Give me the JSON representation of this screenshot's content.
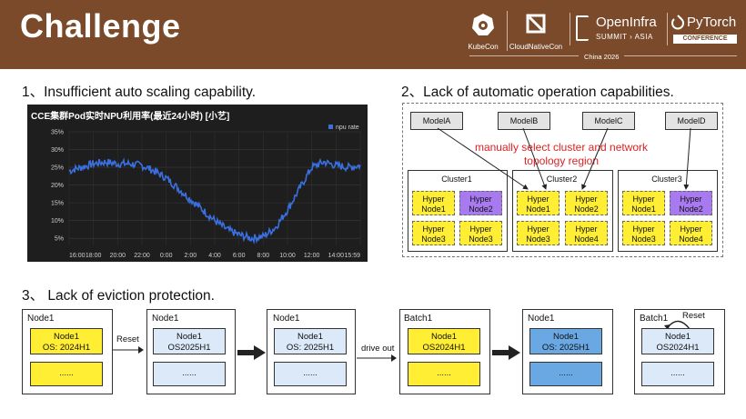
{
  "header": {
    "title": "Challenge",
    "logos": [
      {
        "name": "KubeCon",
        "label": "KubeCon"
      },
      {
        "name": "CloudNativeCon",
        "label": "CloudNativeCon"
      },
      {
        "name": "OpenInfra",
        "label": "OpenInfra",
        "sub": "SUMMIT › ASIA"
      },
      {
        "name": "PyTorch",
        "label": "PyTorch",
        "sub": "CONFERENCE"
      }
    ],
    "event": "China 2026"
  },
  "section1": {
    "title": "1、Insufficient auto scaling capability.",
    "chart_title": "CCE集群Pod实时NPU利用率(最近24小时) [小艺]",
    "legend": "npu rate"
  },
  "chart_data": {
    "type": "line",
    "title": "CCE集群Pod实时NPU利用率(最近24小时) [小艺]",
    "xlabel": "",
    "ylabel": "",
    "x_ticks": [
      "16:00",
      "18:00",
      "20:00",
      "22:00",
      "0:00",
      "2:00",
      "4:00",
      "6:00",
      "8:00",
      "10:00",
      "12:00",
      "14:00",
      "15:59"
    ],
    "y_ticks": [
      "35%",
      "30%",
      "25%",
      "20%",
      "15%",
      "10%",
      "5%"
    ],
    "ylim": [
      3,
      35
    ],
    "grid": true,
    "legend_position": "top-right",
    "series": [
      {
        "name": "npu rate",
        "color": "#3a6fe0",
        "x": [
          0,
          1,
          2,
          3,
          4,
          5,
          6,
          7,
          8,
          9,
          10,
          11,
          12,
          13,
          14,
          15,
          16,
          17,
          18,
          19,
          20,
          21,
          22,
          23,
          24
        ],
        "values": [
          24,
          25,
          26,
          26.5,
          26,
          26,
          25.5,
          24,
          22,
          19,
          16,
          13,
          10,
          7.5,
          6,
          5,
          5.5,
          8,
          13,
          19,
          25,
          26.5,
          25.5,
          25,
          25.5
        ]
      }
    ]
  },
  "section2": {
    "title": "2、Lack of automatic operation capabilities.",
    "models": [
      "ModelA",
      "ModelB",
      "ModelC",
      "ModelD"
    ],
    "note": "manually select cluster and network topology region",
    "clusters": [
      {
        "label": "Cluster1",
        "nodes": [
          "Hyper Node1",
          "Hyper Node2",
          "Hyper Node3",
          "Hyper Node3"
        ],
        "colors": [
          "yellow",
          "purple",
          "yellow",
          "yellow"
        ]
      },
      {
        "label": "Cluster2",
        "nodes": [
          "Hyper Node1",
          "Hyper Node2",
          "Hyper Node3",
          "Hyper Node4"
        ],
        "colors": [
          "yellow",
          "yellow",
          "yellow",
          "yellow"
        ]
      },
      {
        "label": "Cluster3",
        "nodes": [
          "Hyper Node1",
          "Hyper Node2",
          "Hyper Node3",
          "Hyper Node4"
        ],
        "colors": [
          "yellow",
          "purple",
          "yellow",
          "yellow"
        ]
      }
    ]
  },
  "section3": {
    "title": "3、 Lack of eviction protection.",
    "boxes": [
      {
        "title": "Node1",
        "top_l1": "Node1",
        "top_l2": "OS: 2024H1",
        "bottom": "......",
        "top_color": "yellow",
        "bottom_color": "yellow"
      },
      {
        "title": "Node1",
        "top_l1": "Node1",
        "top_l2": "OS2025H1",
        "bottom": "......",
        "top_color": "lightblue",
        "bottom_color": "lightblue"
      },
      {
        "title": "Node1",
        "top_l1": "Node1",
        "top_l2": "OS:  2025H1",
        "bottom": "......",
        "top_color": "lightblue",
        "bottom_color": "lightblue"
      },
      {
        "title": "Batch1",
        "top_l1": "Node1",
        "top_l2": "OS2024H1",
        "bottom": "......",
        "top_color": "yellow",
        "bottom_color": "yellow"
      },
      {
        "title": "Node1",
        "top_l1": "Node1",
        "top_l2": "OS:  2025H1",
        "bottom": "......",
        "top_color": "blue",
        "bottom_color": "blue"
      },
      {
        "title": "Batch1",
        "top_l1": "Node1",
        "top_l2": "OS2024H1",
        "bottom": "......",
        "top_color": "lightblue",
        "bottom_color": "lightblue"
      }
    ],
    "reset_label": "Reset",
    "drive_out_label": "drive out",
    "reset_label_2": "Reset"
  }
}
